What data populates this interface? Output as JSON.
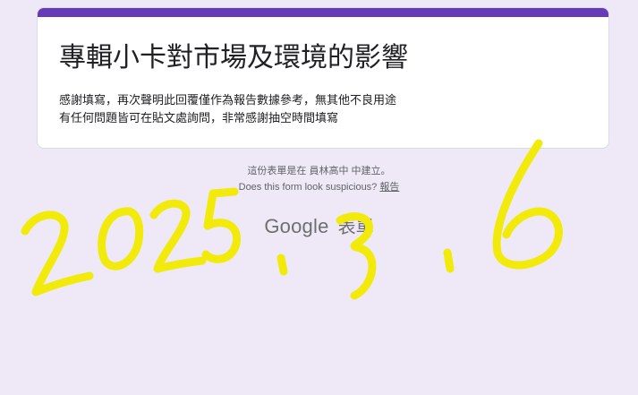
{
  "form": {
    "title": "專輯小卡對市場及環境的影響",
    "description_lines": [
      "感謝填寫，再次聲明此回覆僅作為報告數據參考，無其他不良用途",
      "有任何問題皆可在貼文處詢問，非常感謝抽空時間填寫"
    ],
    "accent_color": "#673ab7"
  },
  "footer": {
    "created_in": "這份表單是在 員林高中 中建立。",
    "suspicious_text": "Does this form look suspicious?",
    "report_link": "報告"
  },
  "brand": {
    "google": "Google",
    "forms": "表單"
  },
  "handwriting": {
    "text": "2025.3.6",
    "color": "#f2ea0a"
  },
  "page_background": "#efe9f7"
}
